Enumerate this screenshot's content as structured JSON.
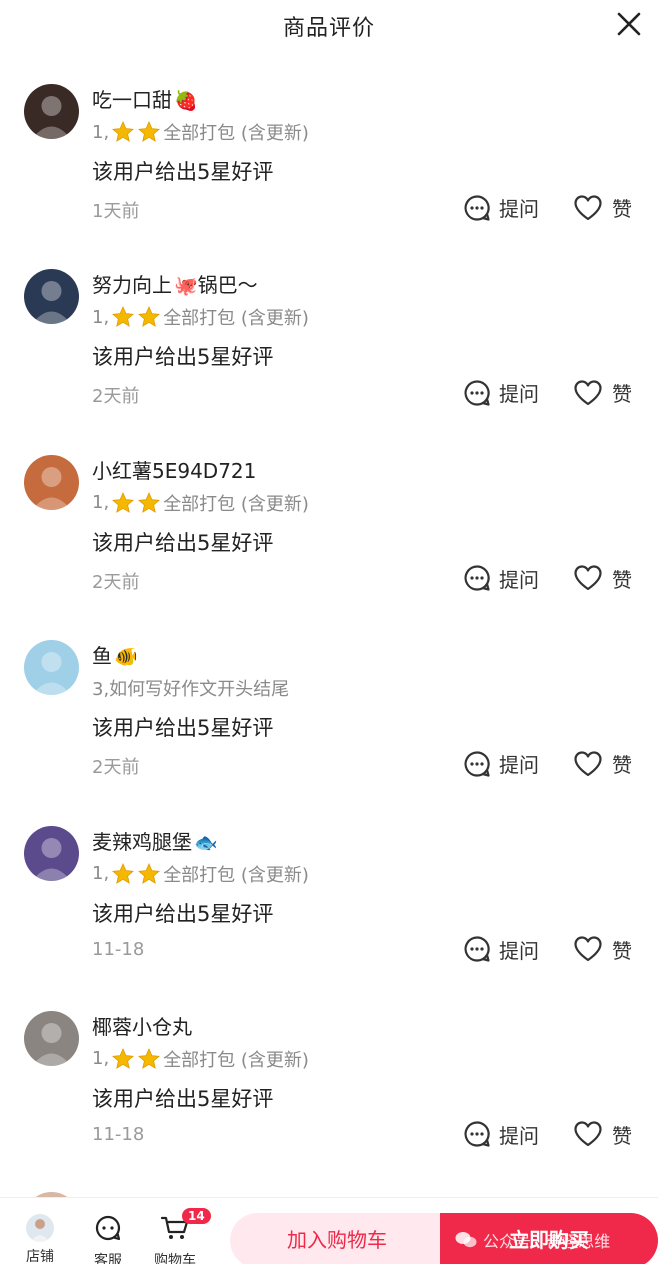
{
  "header": {
    "title": "商品评价",
    "close_icon": "close-icon"
  },
  "reviews": [
    {
      "user": "吃一口甜",
      "emoji": "🍓",
      "spec_prefix": "1,",
      "spec_stars": 2,
      "spec_text": "全部打包 (含更新)",
      "content": "该用户给出5星好评",
      "time": "1天前",
      "ask": "提问",
      "like": "赞",
      "avatar_color": "#3a2a25"
    },
    {
      "user": "努力向上",
      "emoji": "🐙",
      "user_suffix": "锅巴～",
      "spec_prefix": "1,",
      "spec_stars": 2,
      "spec_text": "全部打包 (含更新)",
      "content": "该用户给出5星好评",
      "time": "2天前",
      "ask": "提问",
      "like": "赞",
      "avatar_color": "#2a3a55"
    },
    {
      "user": "小红薯5E94D721",
      "emoji": "",
      "spec_prefix": "1,",
      "spec_stars": 2,
      "spec_text": "全部打包 (含更新)",
      "content": "该用户给出5星好评",
      "time": "2天前",
      "ask": "提问",
      "like": "赞",
      "avatar_color": "#c66b3d"
    },
    {
      "user": "鱼",
      "emoji": "🐠",
      "spec_prefix": "",
      "spec_stars": 0,
      "spec_text": "3,如何写好作文开头结尾",
      "content": "该用户给出5星好评",
      "time": "2天前",
      "ask": "提问",
      "like": "赞",
      "avatar_color": "#9fd0e8"
    },
    {
      "user": "麦辣鸡腿堡",
      "emoji": "🐟",
      "spec_prefix": "1,",
      "spec_stars": 2,
      "spec_text": "全部打包 (含更新)",
      "content": "该用户给出5星好评",
      "time": "11-18",
      "ask": "提问",
      "like": "赞",
      "avatar_color": "#5b4a8c"
    },
    {
      "user": "椰蓉小仓丸",
      "emoji": "",
      "spec_prefix": "1,",
      "spec_stars": 2,
      "spec_text": "全部打包 (含更新)",
      "content": "该用户给出5星好评",
      "time": "11-18",
      "ask": "提问",
      "like": "赞",
      "avatar_color": "#8a8580"
    }
  ],
  "bottom": {
    "store_label": "店铺",
    "service_label": "客服",
    "cart_label": "购物车",
    "cart_badge": "14",
    "add_to_cart": "加入购物车",
    "buy_now": "立即购买"
  },
  "watermark": {
    "text": "公众号 · 奇怪思维"
  },
  "colors": {
    "accent": "#f0294a",
    "accent_light": "#ffe9ee",
    "star": "#f5b800",
    "muted": "#8a8a8a"
  }
}
